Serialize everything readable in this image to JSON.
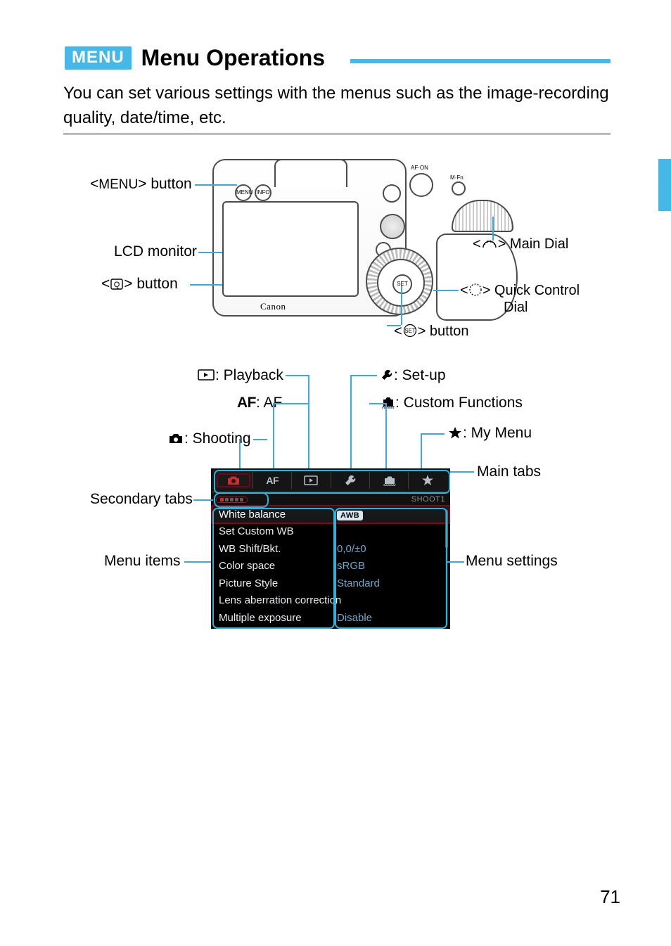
{
  "heading": {
    "badge": "MENU",
    "title": "Menu Operations"
  },
  "intro": "You can set various settings with the menus such as the image-recording quality, date/time, etc.",
  "camera_callouts": {
    "menu_button": "<MENU> button",
    "lcd_monitor": "LCD monitor",
    "q_button_pre": "<",
    "q_button_post": "> button",
    "main_dial_pre": "<",
    "main_dial_post": "> Main Dial",
    "qc_dial_pre": "<",
    "qc_dial_mid": "> Quick Control",
    "qc_dial_sub": "Dial",
    "set_button_pre": "<",
    "set_button_post": "> button"
  },
  "tab_legend": {
    "playback": ": Playback",
    "af": ": AF",
    "shooting": ": Shooting",
    "setup": ": Set-up",
    "custom": ": Custom Functions",
    "mymenu": ": My Menu"
  },
  "menu_callouts": {
    "secondary_tabs": "Secondary tabs",
    "menu_items": "Menu items",
    "main_tabs": "Main tabs",
    "menu_settings": "Menu settings"
  },
  "menu_shot": {
    "sub_label": "SHOOT1",
    "rows": [
      {
        "label": "White balance",
        "value": "AWB",
        "badge": true,
        "selected": true
      },
      {
        "label": "Set Custom WB",
        "value": ""
      },
      {
        "label": "WB Shift/Bkt.",
        "value": "0,0/±0"
      },
      {
        "label": "Color space",
        "value": "sRGB"
      },
      {
        "label": "Picture Style",
        "value": "Standard"
      },
      {
        "label": "Lens aberration correction",
        "value": ""
      },
      {
        "label": "Multiple exposure",
        "value": "Disable"
      }
    ]
  },
  "camera_logo": "Canon",
  "page_number": "71"
}
